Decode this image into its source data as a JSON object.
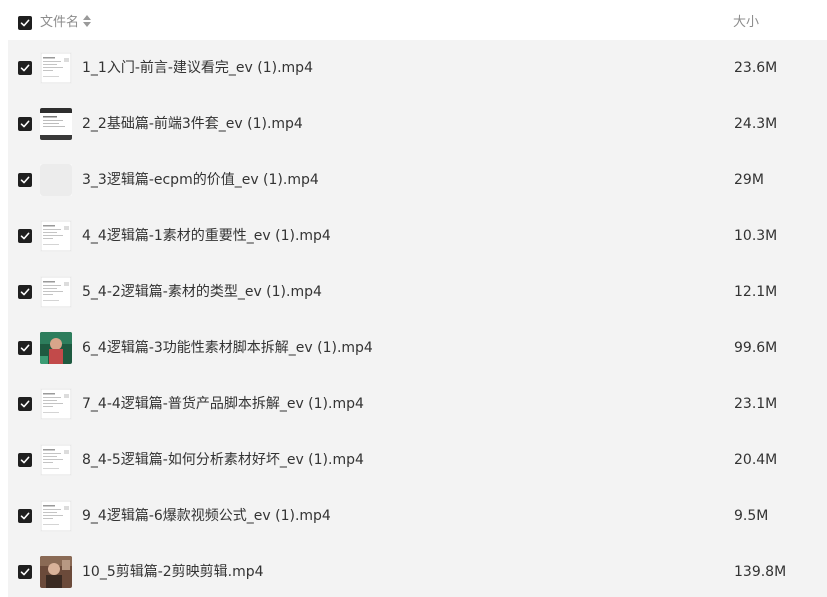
{
  "header": {
    "name_label": "文件名",
    "size_label": "大小",
    "sort_icon": "sort-icon",
    "checkbox_icon": "checkbox-checked-icon"
  },
  "colors": {
    "row_background": "#f3f3f3",
    "checkbox_fill": "#1f1f1f",
    "header_text": "#8c8c8c",
    "body_text": "#333333"
  },
  "files": [
    {
      "name": "1_1入门-前言-建议看完_ev (1).mp4",
      "size": "23.6M",
      "thumb": "screen"
    },
    {
      "name": "2_2基础篇-前端3件套_ev (1).mp4",
      "size": "24.3M",
      "thumb": "screen-dark"
    },
    {
      "name": "3_3逻辑篇-ecpm的价值_ev (1).mp4",
      "size": "29M",
      "thumb": "blank"
    },
    {
      "name": "4_4逻辑篇-1素材的重要性_ev (1).mp4",
      "size": "10.3M",
      "thumb": "screen"
    },
    {
      "name": "5_4-2逻辑篇-素材的类型_ev (1).mp4",
      "size": "12.1M",
      "thumb": "screen"
    },
    {
      "name": "6_4逻辑篇-3功能性素材脚本拆解_ev (1).mp4",
      "size": "99.6M",
      "thumb": "photo-green"
    },
    {
      "name": "7_4-4逻辑篇-普货产品脚本拆解_ev (1).mp4",
      "size": "23.1M",
      "thumb": "screen"
    },
    {
      "name": "8_4-5逻辑篇-如何分析素材好坏_ev (1).mp4",
      "size": "20.4M",
      "thumb": "screen"
    },
    {
      "name": "9_4逻辑篇-6爆款视频公式_ev (1).mp4",
      "size": "9.5M",
      "thumb": "screen"
    },
    {
      "name": "10_5剪辑篇-2剪映剪辑.mp4",
      "size": "139.8M",
      "thumb": "photo-brown"
    }
  ]
}
